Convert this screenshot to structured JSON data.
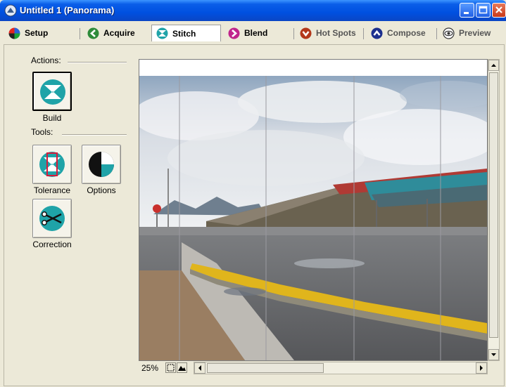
{
  "window": {
    "title": "Untitled 1 (Panorama)"
  },
  "tabs": [
    {
      "label": "Setup",
      "icon": "setup-icon",
      "color": "#1a64d0"
    },
    {
      "label": "Acquire",
      "icon": "acquire-arrow-icon",
      "color": "#2e8b3a"
    },
    {
      "label": "Stitch",
      "icon": "stitch-icon",
      "color": "#1fa3a8"
    },
    {
      "label": "Blend",
      "icon": "blend-arrow-icon",
      "color": "#c0248c"
    },
    {
      "label": "Hot Spots",
      "icon": "hotspots-arrow-icon",
      "color": "#b3381a"
    },
    {
      "label": "Compose",
      "icon": "compose-arrow-icon",
      "color": "#1c2f8e"
    },
    {
      "label": "Preview",
      "icon": "preview-eye-icon",
      "color": "#333333"
    }
  ],
  "active_tab": "Stitch",
  "sidebar": {
    "actions_label": "Actions:",
    "tools_label": "Tools:",
    "build_label": "Build",
    "tolerance_label": "Tolerance",
    "options_label": "Options",
    "correction_label": "Correction"
  },
  "status": {
    "zoom": "25%"
  }
}
